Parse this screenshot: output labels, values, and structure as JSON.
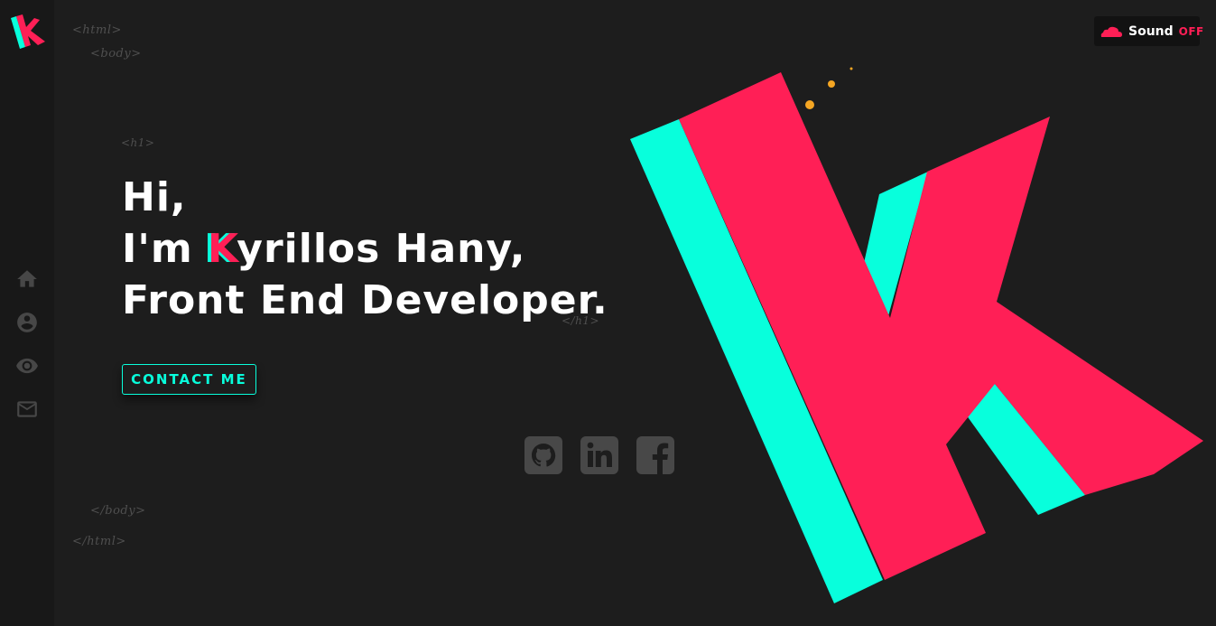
{
  "sidebar": {
    "logo_letter": "K",
    "nav": [
      {
        "icon": "home-icon"
      },
      {
        "icon": "user-icon"
      },
      {
        "icon": "eye-icon"
      },
      {
        "icon": "mail-icon"
      }
    ]
  },
  "tags": {
    "html_open": "<html>",
    "body_open": "<body>",
    "h1_open": "<h1>",
    "h1_close": "</h1>",
    "body_close": "</body>",
    "html_close": "</html>"
  },
  "hero": {
    "line1": "Hi,",
    "line2_prefix": "I'm ",
    "line2_k": "K",
    "line2_rest": "yrillos Hany,",
    "line3": "Front End Developer."
  },
  "contact_button": "CONTACT ME",
  "social": [
    {
      "icon": "github-icon"
    },
    {
      "icon": "linkedin-icon"
    },
    {
      "icon": "facebook-icon"
    }
  ],
  "sound": {
    "icon": "soundcloud-icon",
    "label": "Sound",
    "state": "OFF"
  },
  "colors": {
    "background": "#1d1d1d",
    "sidebar": "#181818",
    "accent_pink": "#ff1f56",
    "accent_cyan": "#08ffdc",
    "dots": "#f5a623"
  }
}
